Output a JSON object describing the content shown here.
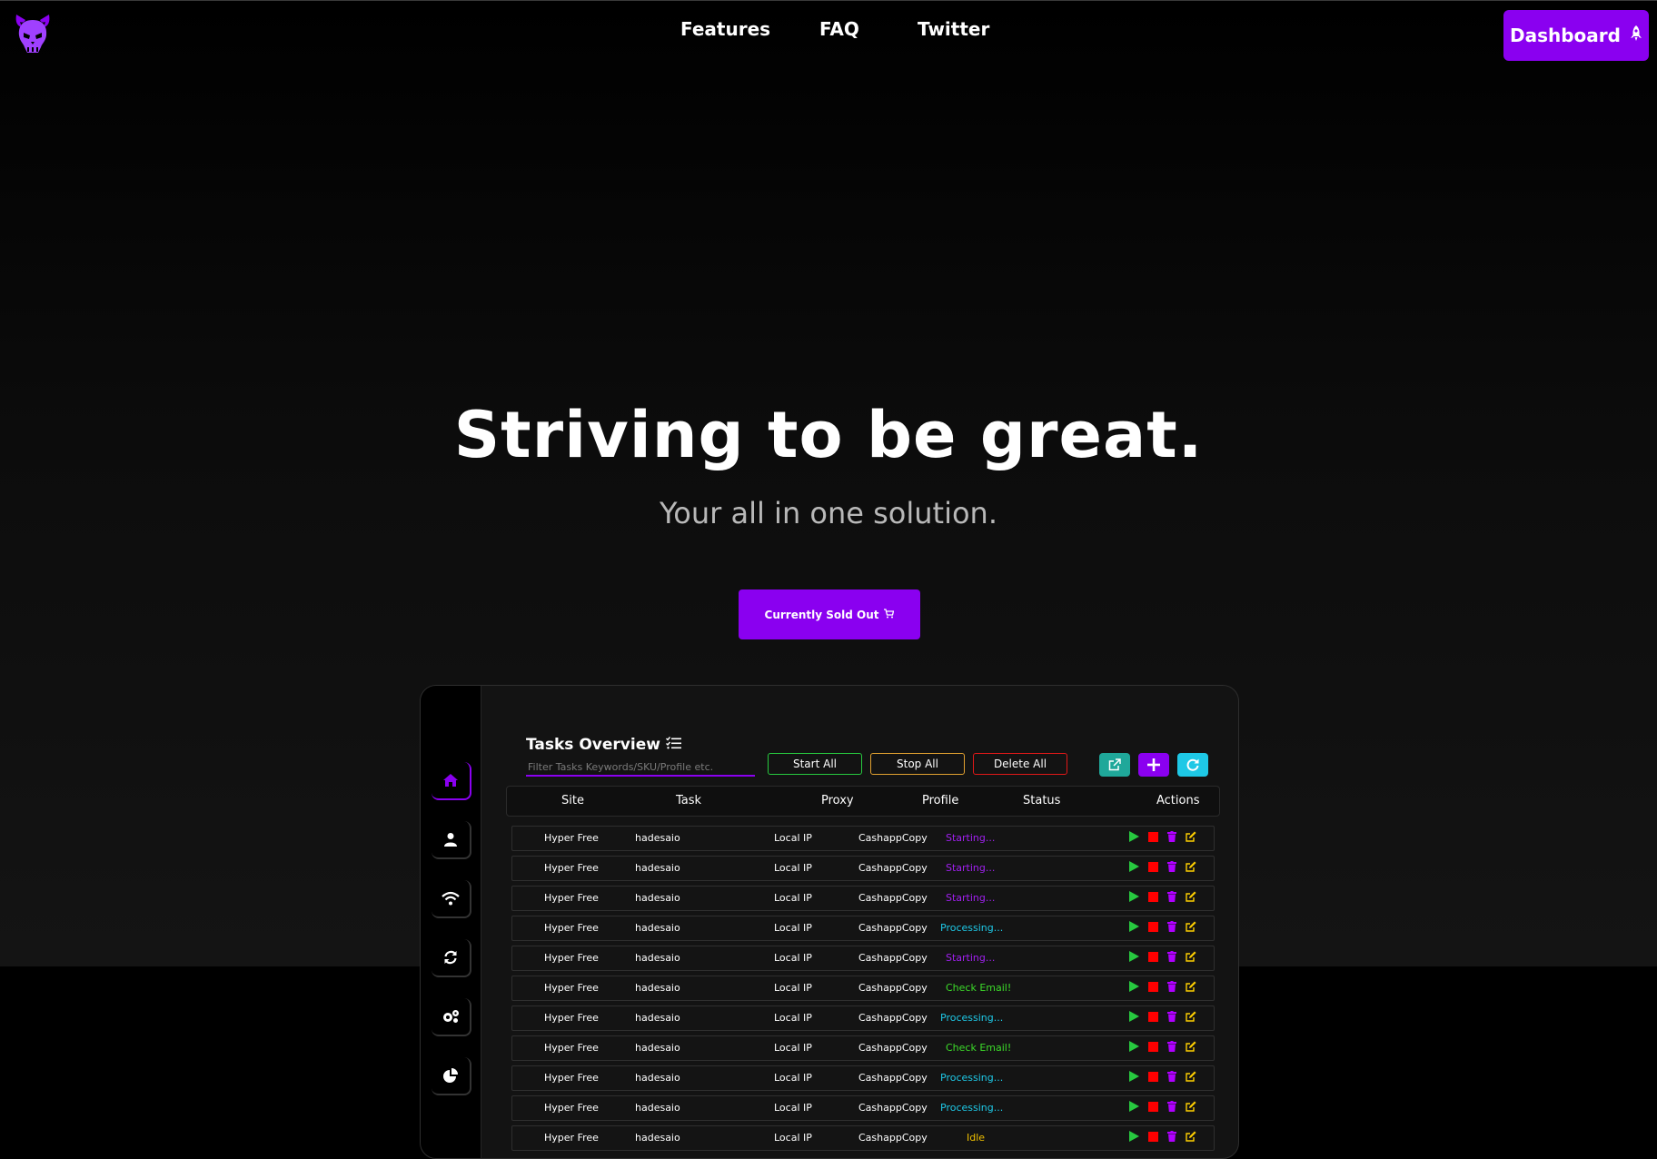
{
  "colors": {
    "accent": "#8a00f0",
    "start": "#27c93f",
    "stop": "#ff0000",
    "delete": "#b000ff",
    "edit": "#ffd000"
  },
  "nav": {
    "logo_icon": "devil-skull-icon",
    "links": [
      "Features",
      "FAQ",
      "Twitter"
    ],
    "dashboard_label": "Dashboard",
    "dashboard_icon": "rocket-icon"
  },
  "hero": {
    "title": "Striving to be great.",
    "subtitle": "Your all in one solution.",
    "cta_label": "Currently Sold Out",
    "cta_icon": "cart-icon"
  },
  "app": {
    "sidebar_icons": [
      "home-icon",
      "user-icon",
      "wifi-icon",
      "sync-icon",
      "gears-icon",
      "pie-chart-icon"
    ],
    "title": "Tasks Overview",
    "title_icon": "task-list-icon",
    "filter_placeholder": "Filter Tasks Keywords/SKU/Profile etc.",
    "buttons": {
      "start_all": "Start All",
      "stop_all": "Stop All",
      "delete_all": "Delete All"
    },
    "icon_buttons": [
      "external-link-icon",
      "plus-icon",
      "refresh-icon"
    ],
    "columns": [
      "Site",
      "Task",
      "Proxy",
      "Profile",
      "Status",
      "Actions"
    ],
    "status_colors": {
      "Starting...": "#a020f0",
      "Processing...": "#1ec8e6",
      "Check Email!": "#3ddc2a",
      "Idle": "#f0c000"
    },
    "rows": [
      {
        "site": "Hyper Free",
        "task": "hadesaio",
        "proxy": "Local IP",
        "profile": "CashappCopy",
        "status": "Starting..."
      },
      {
        "site": "Hyper Free",
        "task": "hadesaio",
        "proxy": "Local IP",
        "profile": "CashappCopy",
        "status": "Starting..."
      },
      {
        "site": "Hyper Free",
        "task": "hadesaio",
        "proxy": "Local IP",
        "profile": "CashappCopy",
        "status": "Starting..."
      },
      {
        "site": "Hyper Free",
        "task": "hadesaio",
        "proxy": "Local IP",
        "profile": "CashappCopy",
        "status": "Processing..."
      },
      {
        "site": "Hyper Free",
        "task": "hadesaio",
        "proxy": "Local IP",
        "profile": "CashappCopy",
        "status": "Starting..."
      },
      {
        "site": "Hyper Free",
        "task": "hadesaio",
        "proxy": "Local IP",
        "profile": "CashappCopy",
        "status": "Check Email!"
      },
      {
        "site": "Hyper Free",
        "task": "hadesaio",
        "proxy": "Local IP",
        "profile": "CashappCopy",
        "status": "Processing..."
      },
      {
        "site": "Hyper Free",
        "task": "hadesaio",
        "proxy": "Local IP",
        "profile": "CashappCopy",
        "status": "Check Email!"
      },
      {
        "site": "Hyper Free",
        "task": "hadesaio",
        "proxy": "Local IP",
        "profile": "CashappCopy",
        "status": "Processing..."
      },
      {
        "site": "Hyper Free",
        "task": "hadesaio",
        "proxy": "Local IP",
        "profile": "CashappCopy",
        "status": "Processing..."
      },
      {
        "site": "Hyper Free",
        "task": "hadesaio",
        "proxy": "Local IP",
        "profile": "CashappCopy",
        "status": "Idle"
      }
    ],
    "row_actions": [
      "play-icon",
      "stop-icon",
      "trash-icon",
      "edit-icon"
    ]
  }
}
